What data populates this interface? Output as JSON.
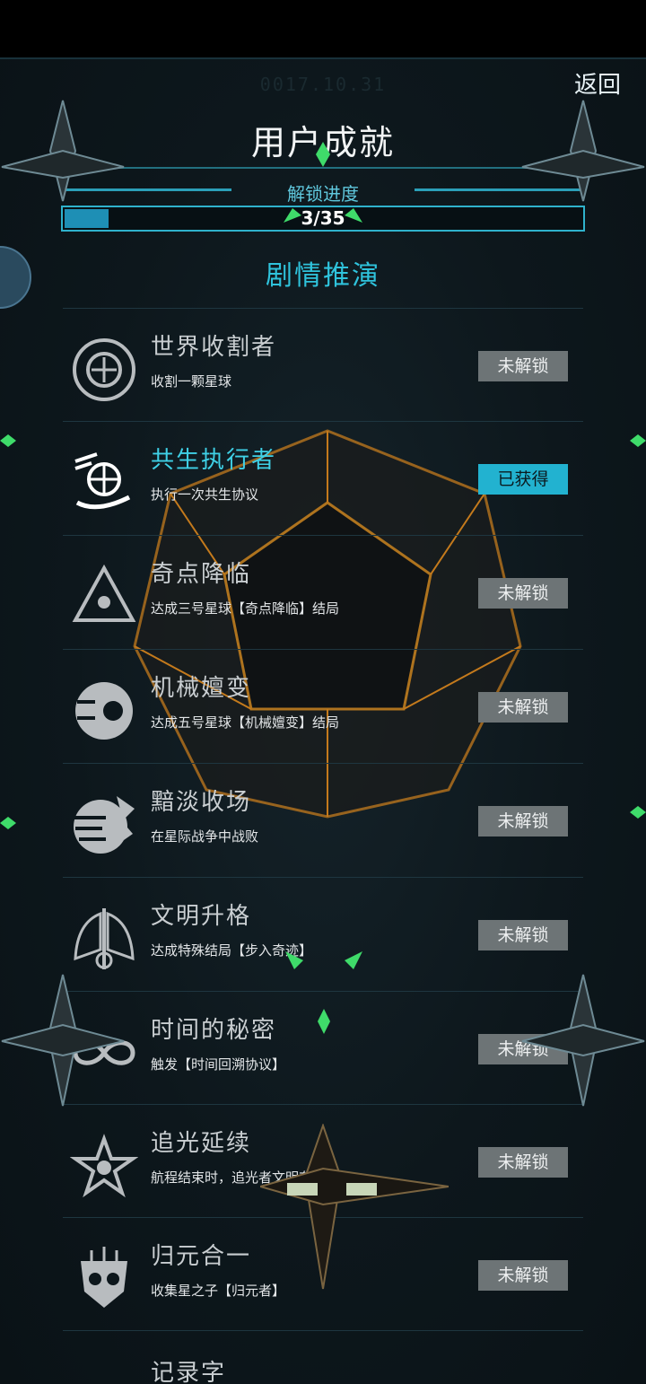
{
  "header": {
    "date": "0017.10.31",
    "back_label": "返回",
    "title": "用户成就",
    "progress_label": "解锁进度",
    "progress_text": "3/35",
    "progress_fraction": 0.0857
  },
  "section": {
    "title": "剧情推演"
  },
  "colors": {
    "accent": "#2fc3dc",
    "locked_badge": "#6d7476",
    "unlocked_badge": "#22b2d0"
  },
  "achievements": [
    {
      "name": "世界收割者",
      "desc": "收割一颗星球",
      "status": "未解锁",
      "unlocked": false,
      "icon": "harvest-globe-icon"
    },
    {
      "name": "共生执行者",
      "desc": "执行一次共生协议",
      "status": "已获得",
      "unlocked": true,
      "icon": "hand-globe-icon"
    },
    {
      "name": "奇点降临",
      "desc": "达成三号星球【奇点降临】结局",
      "status": "未解锁",
      "unlocked": false,
      "icon": "triangle-eye-icon"
    },
    {
      "name": "机械嬗变",
      "desc": "达成五号星球【机械嬗变】结局",
      "status": "未解锁",
      "unlocked": false,
      "icon": "mech-eye-icon"
    },
    {
      "name": "黯淡收场",
      "desc": "在星际战争中战败",
      "status": "未解锁",
      "unlocked": false,
      "icon": "broken-planet-icon"
    },
    {
      "name": "文明升格",
      "desc": "达成特殊结局【步入奇迹】",
      "status": "未解锁",
      "unlocked": false,
      "icon": "winged-emblem-icon"
    },
    {
      "name": "时间的秘密",
      "desc": "触发【时间回溯协议】",
      "status": "未解锁",
      "unlocked": false,
      "icon": "infinity-icon"
    },
    {
      "name": "追光延续",
      "desc": "航程结束时，追光者文明存活",
      "status": "未解锁",
      "unlocked": false,
      "icon": "star-wings-icon"
    },
    {
      "name": "归元合一",
      "desc": "收集星之子【归元者】",
      "status": "未解锁",
      "unlocked": false,
      "icon": "mask-icon"
    }
  ],
  "partial_next_item": {
    "name": "记录字"
  }
}
